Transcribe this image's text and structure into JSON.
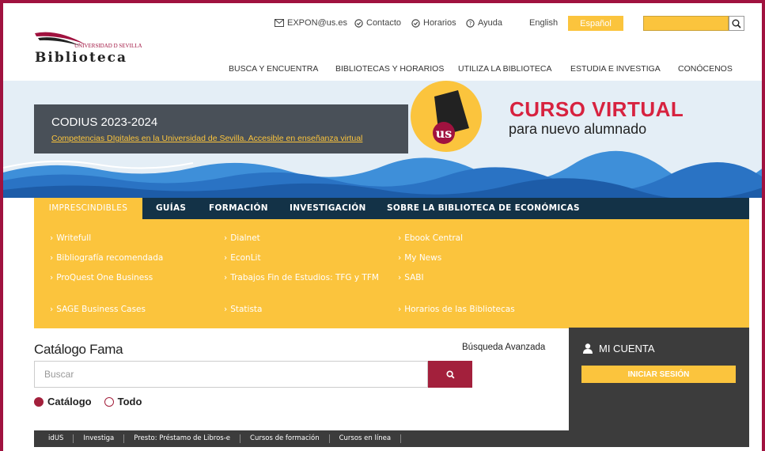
{
  "topbar": {
    "email": "EXPON@us.es",
    "contact": "Contacto",
    "hours": "Horarios",
    "help": "Ayuda",
    "lang_en": "English",
    "lang_es": "Español"
  },
  "logo": {
    "university": "UNIVERSIDAD D SEVILLA",
    "library": "Biblioteca"
  },
  "main_nav": [
    "BUSCA Y ENCUENTRA",
    "BIBLIOTECAS Y HORARIOS",
    "UTILIZA LA BIBLIOTECA",
    "ESTUDIA E INVESTIGA",
    "CONÓCENOS"
  ],
  "hero": {
    "title": "CODIUS 2023-2024",
    "link": "Competencias DIgitales en la Universidad de Sevilla. Accesible en enseñanza virtual",
    "headline": "CURSO VIRTUAL",
    "subheadline": "para nuevo alumnado"
  },
  "tabs": [
    "IMPRESCINDIBLES",
    "GUÍAS",
    "FORMACIÓN",
    "INVESTIGACIÓN",
    "SOBRE LA BIBLIOTECA DE ECONÓMICAS"
  ],
  "links": [
    [
      "Writefull",
      "Bibliografía recomendada",
      "ProQuest One Business",
      "SAGE Business Cases"
    ],
    [
      "Dialnet",
      "EconLit",
      "Trabajos Fin de Estudios: TFG y TFM",
      "Statista"
    ],
    [
      "Ebook Central",
      "My News",
      "SABI",
      "Horarios de las Bibliotecas"
    ]
  ],
  "catalog": {
    "title": "Catálogo Fama",
    "advanced": "Búsqueda Avanzada",
    "placeholder": "Buscar",
    "radio_catalog": "Catálogo",
    "radio_all": "Todo"
  },
  "account": {
    "title": "MI CUENTA",
    "login": "INICIAR SESIÓN"
  },
  "bottom_links": [
    "idUS",
    "Investiga",
    "Presto: Préstamo de Libros-e",
    "Cursos de formación",
    "Cursos en línea"
  ],
  "colors": {
    "brand": "#a0123f",
    "accent": "#fbc43d",
    "navy": "#133247"
  }
}
